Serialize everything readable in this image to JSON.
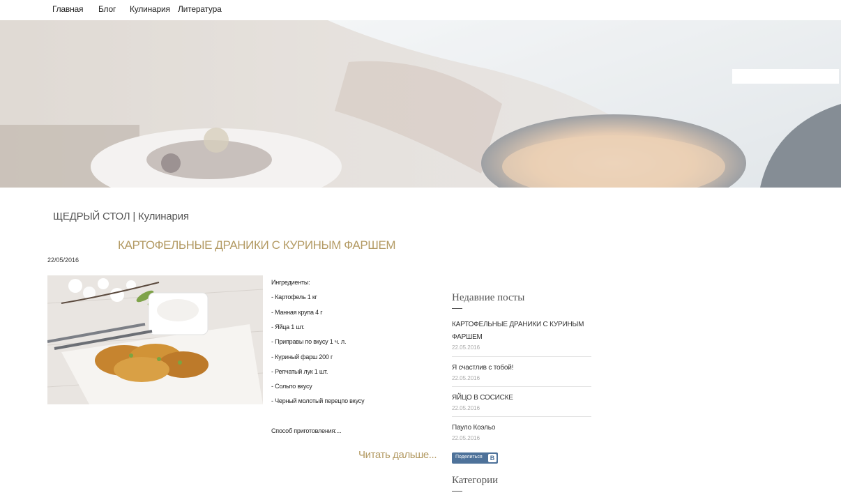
{
  "nav": {
    "items": [
      {
        "label": "Главная"
      },
      {
        "label": "Блог"
      },
      {
        "label": "Кулинария"
      },
      {
        "label": "Литература"
      }
    ]
  },
  "hero": {
    "search_placeholder": ""
  },
  "page": {
    "site_title": "ЩЕДРЫЙ СТОЛ | Кулинария"
  },
  "post": {
    "title": "КАРТОФЕЛЬНЫЕ ДРАНИКИ С КУРИНЫМ ФАРШЕМ",
    "date": "22/05/2016",
    "ingredients": [
      "Ингредиенты:",
      "- Картофель 1 кг",
      "- Манная крупа 4 г",
      "- Яйца 1 шт.",
      "- Приправы по вкусу 1 ч. л.",
      "- Куриный фарш 200 г",
      "- Репчатый лук 1 шт.",
      "- Сольпо вкусу",
      "- Черный молотый перецпо вкусу"
    ],
    "method": "Способ приготовления:...",
    "read_more": "Читать дальше..."
  },
  "sidebar": {
    "recent_heading": "Недавние посты",
    "recent_posts": [
      {
        "title": "КАРТОФЕЛЬНЫЕ ДРАНИКИ С КУРИНЫМ ФАРШЕМ",
        "date": "22.05.2016"
      },
      {
        "title": "Я счастлив с тобой!",
        "date": "22.05.2016"
      },
      {
        "title": "ЯЙЦО В СОСИСКЕ",
        "date": "22.05.2016"
      },
      {
        "title": "Пауло Коэльо",
        "date": "22.05.2016"
      }
    ],
    "share_label": "Поделиться",
    "share_icon": "В",
    "categories_heading": "Категории"
  },
  "colors": {
    "accent": "#b39a63",
    "share": "#4e729a"
  }
}
